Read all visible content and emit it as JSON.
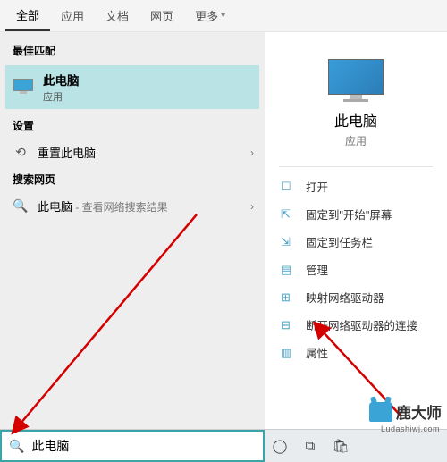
{
  "tabs": {
    "all": "全部",
    "apps": "应用",
    "docs": "文档",
    "web": "网页",
    "more": "更多"
  },
  "left": {
    "best_match": "最佳匹配",
    "best_item": {
      "title": "此电脑",
      "subtitle": "应用"
    },
    "settings_head": "设置",
    "reset_pc": "重置此电脑",
    "search_web_head": "搜索网页",
    "web_item_prefix": "此电脑",
    "web_item_suffix": " - 查看网络搜索结果"
  },
  "right": {
    "title": "此电脑",
    "subtitle": "应用",
    "actions": {
      "open": "打开",
      "pin_start": "固定到\"开始\"屏幕",
      "pin_taskbar": "固定到任务栏",
      "manage": "管理",
      "map_drive": "映射网络驱动器",
      "disconnect_drive": "断开网络驱动器的连接",
      "properties": "属性"
    }
  },
  "search": {
    "value": "此电脑"
  },
  "watermark": {
    "brand": "鹿大师",
    "url": "Ludashiwj.com"
  }
}
